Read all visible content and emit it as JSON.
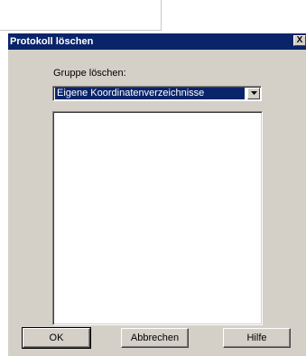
{
  "window": {
    "title": "Protokoll löschen",
    "close_label": "X"
  },
  "form": {
    "group_label": "Gruppe löschen:",
    "group_selected": "Eigene Koordinatenverzeichnisse"
  },
  "buttons": {
    "ok": "OK",
    "cancel": "Abbrechen",
    "help": "Hilfe"
  },
  "colors": {
    "titlebar": "#0a246a",
    "dialog_bg": "#d4d0c8"
  }
}
